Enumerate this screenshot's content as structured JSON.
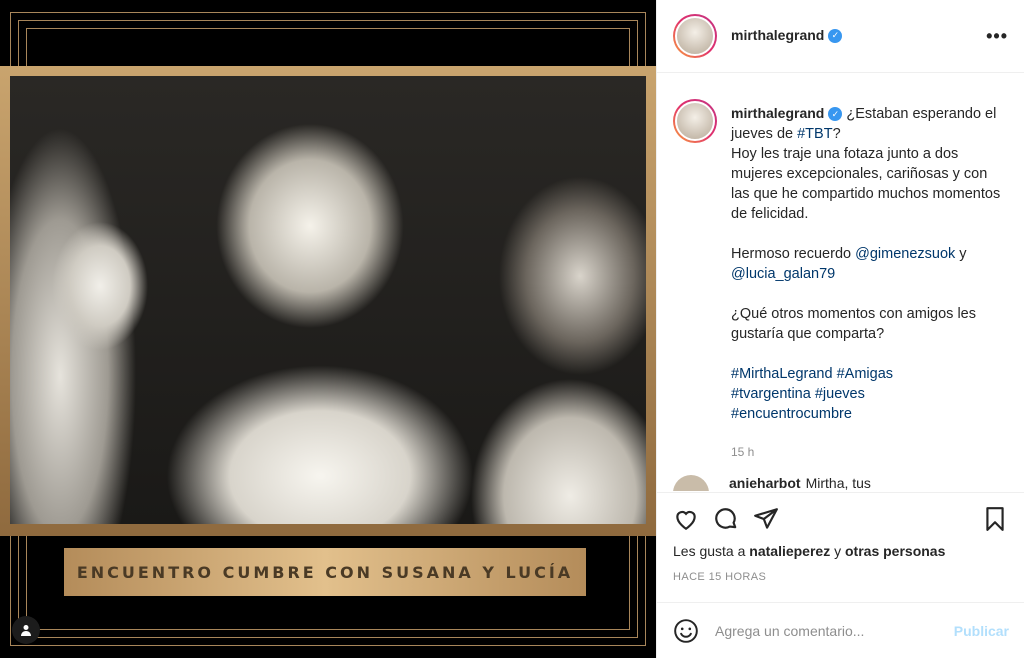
{
  "post": {
    "caption_banner": "ENCUENTRO CUMBRE CON SUSANA Y LUCÍA"
  },
  "header": {
    "username": "mirthalegrand",
    "verified_icon": "verified-badge-icon",
    "more_icon": "more-options-icon",
    "more_label": "•••"
  },
  "caption": {
    "username": "mirthalegrand",
    "line1": "¿Estaban esperando el jueves de ",
    "tbt": "#TBT",
    "line1_end": "?",
    "line2": "Hoy les traje una fotaza junto a dos mujeres excepcionales, cariñosas y con las que he compartido muchos momentos de felicidad.",
    "p2_start": "Hermoso recuerdo ",
    "mention1": "@gimenezsuok",
    "p2_mid": " y ",
    "mention2": "@lucia_galan79",
    "p3": "¿Qué otros momentos con amigos les gustaría que comparta?",
    "tag1": "#MirthaLegrand",
    "tag2": "#Amigas",
    "tag3": "#tvargentina",
    "tag4": "#jueves",
    "tag5": "#encuentrocumbre",
    "time": "15 h"
  },
  "next_comment": {
    "username": "anieharbot",
    "text": "Mirtha, tus"
  },
  "actions": {
    "like_icon": "heart-icon",
    "comment_icon": "comment-icon",
    "share_icon": "share-icon",
    "save_icon": "bookmark-icon"
  },
  "likes": {
    "prefix": "Les gusta a ",
    "user": "natalieperez",
    "mid": " y ",
    "others": "otras personas"
  },
  "timestamp": "HACE 15 HORAS",
  "comment_box": {
    "placeholder": "Agrega un comentario...",
    "publish": "Publicar",
    "emoji_icon": "emoji-icon"
  },
  "colors": {
    "link": "#00376b",
    "verified": "#3897f0",
    "gold": "#c9a46e"
  }
}
